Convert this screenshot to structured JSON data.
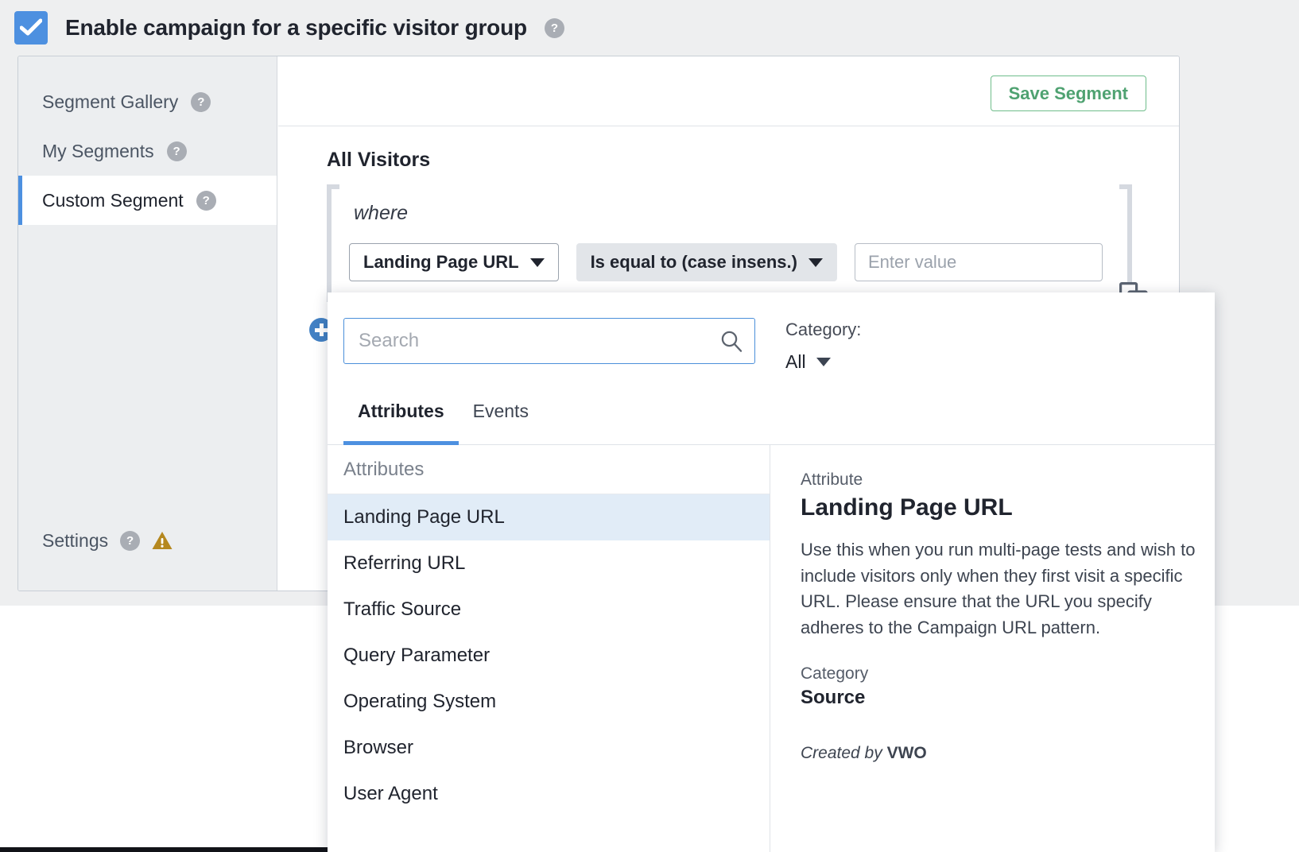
{
  "header": {
    "checkbox_checked": true,
    "title": "Enable campaign for a specific visitor group",
    "help_glyph": "?"
  },
  "sidebar": {
    "items": [
      {
        "label": "Segment Gallery",
        "active": false,
        "help_glyph": "?"
      },
      {
        "label": "My Segments",
        "active": false,
        "help_glyph": "?"
      },
      {
        "label": "Custom Segment",
        "active": true,
        "help_glyph": "?"
      }
    ],
    "settings": {
      "label": "Settings",
      "help_glyph": "?",
      "warning_icon": "warning-triangle-icon"
    }
  },
  "pane": {
    "save_segment_label": "Save Segment",
    "all_visitors_label": "All Visitors",
    "where_label": "where",
    "attribute_select": "Landing Page URL",
    "operator_select": "Is equal to (case insens.)",
    "value_placeholder": "Enter value",
    "value_current": "",
    "duplicate_icon": "duplicate-add-icon",
    "add_condition_icon": "plus-circle-icon"
  },
  "picker": {
    "search_placeholder": "Search",
    "search_value": "",
    "search_icon": "search-icon",
    "category_label": "Category:",
    "category_value": "All",
    "tabs": [
      {
        "label": "Attributes",
        "active": true
      },
      {
        "label": "Events",
        "active": false
      }
    ],
    "list_group_label": "Attributes",
    "items": [
      {
        "label": "Landing Page URL",
        "selected": true
      },
      {
        "label": "Referring URL",
        "selected": false
      },
      {
        "label": "Traffic Source",
        "selected": false
      },
      {
        "label": "Query Parameter",
        "selected": false
      },
      {
        "label": "Operating System",
        "selected": false
      },
      {
        "label": "Browser",
        "selected": false
      },
      {
        "label": "User Agent",
        "selected": false
      }
    ],
    "detail": {
      "kind_label": "Attribute",
      "title": "Landing Page URL",
      "description": "Use this when you run multi-page tests and wish to include visitors only when they first visit a specific URL. Please ensure that the URL you specify adheres to the Campaign URL pattern.",
      "category_label": "Category",
      "category_value": "Source",
      "created_prefix": "Created by ",
      "created_by": "VWO"
    }
  },
  "colors": {
    "accent_blue": "#4d90e0",
    "save_green": "#4fa271",
    "selected_row": "#e1ecf7",
    "warning_gold": "#b5881f",
    "panel_grey": "#eceef0"
  }
}
